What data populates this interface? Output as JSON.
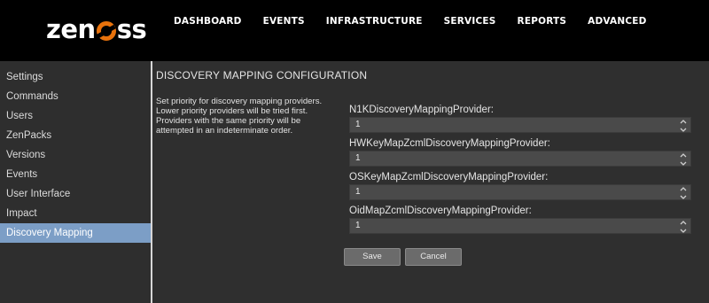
{
  "logo": {
    "text_before": "zen",
    "text_after": "ss"
  },
  "nav": {
    "items": [
      {
        "label": "DASHBOARD"
      },
      {
        "label": "EVENTS"
      },
      {
        "label": "INFRASTRUCTURE"
      },
      {
        "label": "SERVICES"
      },
      {
        "label": "REPORTS"
      },
      {
        "label": "ADVANCED"
      }
    ]
  },
  "sidebar": {
    "items": [
      {
        "label": "Settings"
      },
      {
        "label": "Commands"
      },
      {
        "label": "Users"
      },
      {
        "label": "ZenPacks"
      },
      {
        "label": "Versions"
      },
      {
        "label": "Events"
      },
      {
        "label": "User Interface"
      },
      {
        "label": "Impact"
      },
      {
        "label": "Discovery Mapping",
        "active": true
      }
    ]
  },
  "main": {
    "title": "DISCOVERY MAPPING CONFIGURATION",
    "description": "Set priority for discovery mapping providers. Lower priority providers will be tried first. Providers with the same priority will be attempted in an indeterminate order.",
    "providers": [
      {
        "label": "N1KDiscoveryMappingProvider:",
        "value": "1"
      },
      {
        "label": "HWKeyMapZcmlDiscoveryMappingProvider:",
        "value": "1"
      },
      {
        "label": "OSKeyMapZcmlDiscoveryMappingProvider:",
        "value": "1"
      },
      {
        "label": "OidMapZcmlDiscoveryMappingProvider:",
        "value": "1"
      }
    ],
    "save_label": "Save",
    "cancel_label": "Cancel"
  },
  "colors": {
    "header_bg": "#000000",
    "logo_accent": "#e8720c",
    "active_item": "#7c9ec6",
    "panel_bg": "#2f2f2f"
  }
}
